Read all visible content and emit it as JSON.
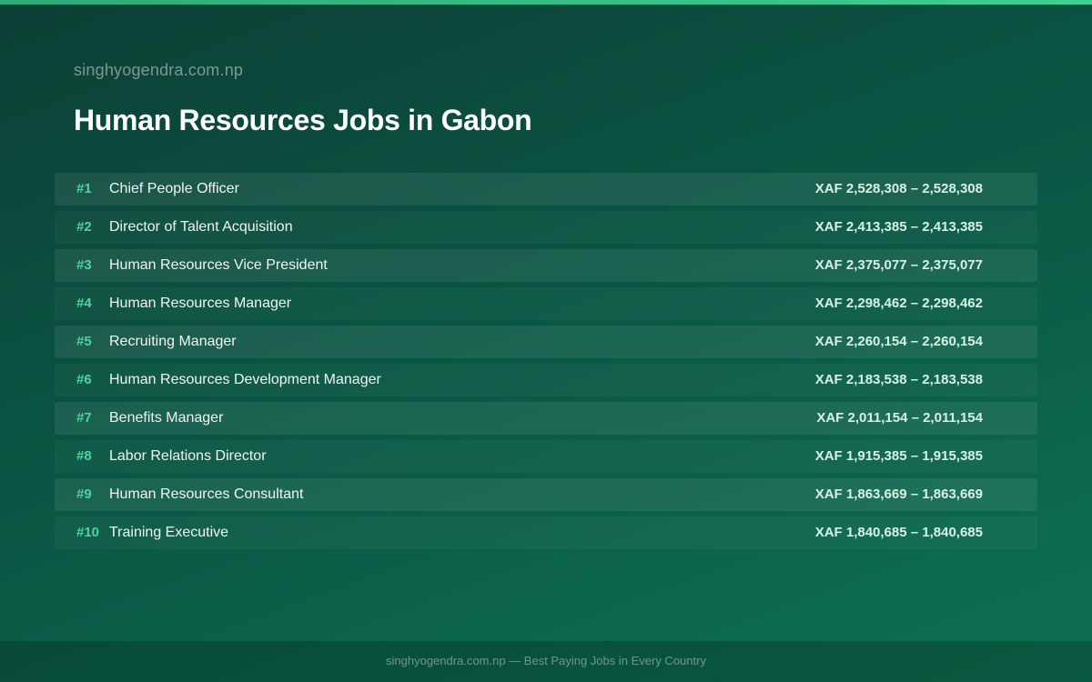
{
  "header": {
    "site_name": "singhyogendra.com.np",
    "title": "Human Resources Jobs in Gabon"
  },
  "jobs": [
    {
      "rank": "#1",
      "title": "Chief People Officer",
      "salary": "XAF 2,528,308 – 2,528,308"
    },
    {
      "rank": "#2",
      "title": "Director of Talent Acquisition",
      "salary": "XAF 2,413,385 – 2,413,385"
    },
    {
      "rank": "#3",
      "title": "Human Resources Vice President",
      "salary": "XAF 2,375,077 – 2,375,077"
    },
    {
      "rank": "#4",
      "title": "Human Resources Manager",
      "salary": "XAF 2,298,462 – 2,298,462"
    },
    {
      "rank": "#5",
      "title": "Recruiting Manager",
      "salary": "XAF 2,260,154 – 2,260,154"
    },
    {
      "rank": "#6",
      "title": "Human Resources Development Manager",
      "salary": "XAF 2,183,538 – 2,183,538"
    },
    {
      "rank": "#7",
      "title": "Benefits Manager",
      "salary": "XAF 2,011,154 – 2,011,154"
    },
    {
      "rank": "#8",
      "title": "Labor Relations Director",
      "salary": "XAF 1,915,385 – 1,915,385"
    },
    {
      "rank": "#9",
      "title": "Human Resources Consultant",
      "salary": "XAF 1,863,669 – 1,863,669"
    },
    {
      "rank": "#10",
      "title": "Training Executive",
      "salary": "XAF 1,840,685 – 1,840,685"
    }
  ],
  "footer": {
    "text": "singhyogendra.com.np — Best Paying Jobs in Every Country"
  },
  "colors": {
    "accent": "#4fd39a",
    "top_bar": "#3ed093",
    "background": "#0a5543"
  }
}
